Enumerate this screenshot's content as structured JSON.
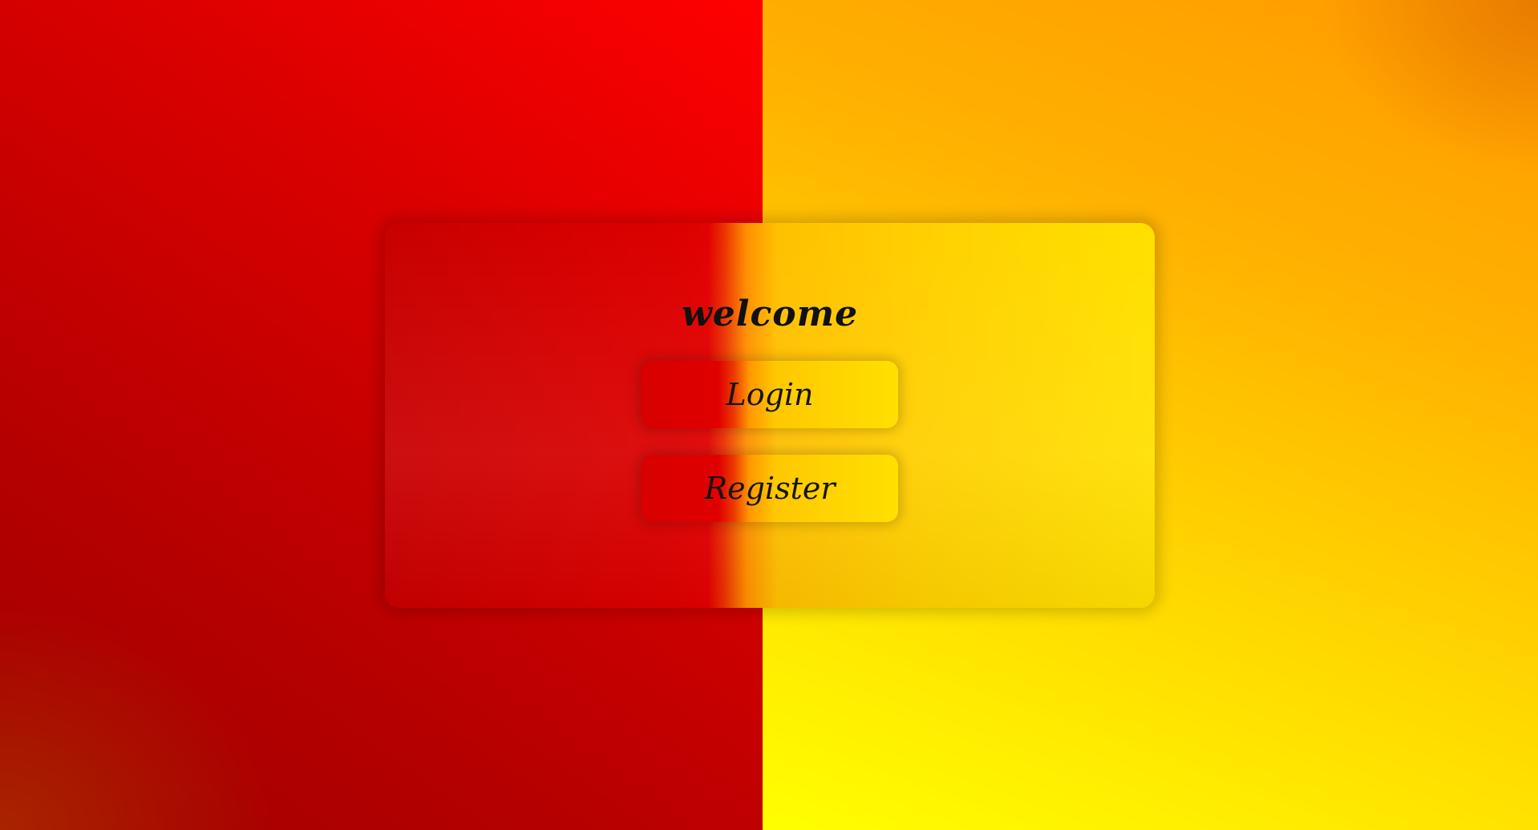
{
  "welcome": {
    "title": "welcome",
    "buttons": {
      "login_label": "Login",
      "register_label": "Register"
    }
  },
  "colors": {
    "left_primary": "#d00000",
    "right_primary": "#ffc800",
    "text": "#111111"
  }
}
